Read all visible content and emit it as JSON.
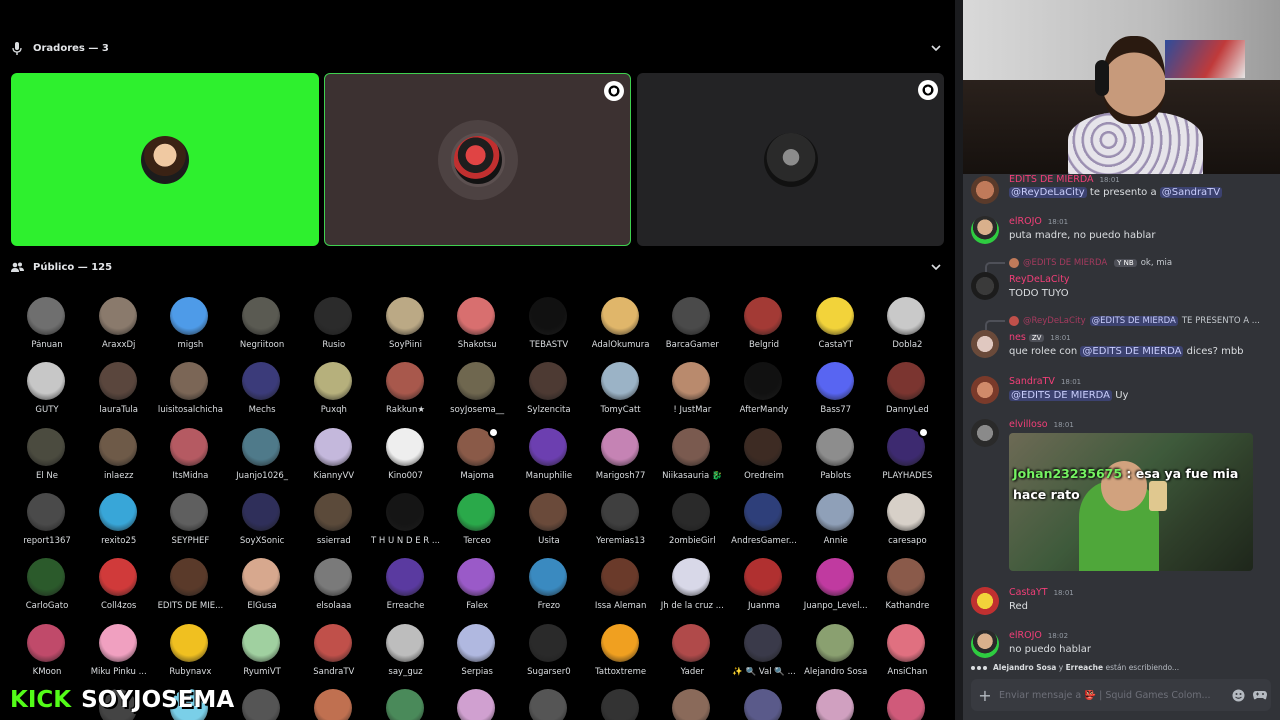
{
  "stage": {
    "speakers_title": "Oradores — 3",
    "audience_title": "Público — 125",
    "tiles": [
      {
        "name": "speaker-tile-1",
        "bg": "#2ef02e",
        "shield": false
      },
      {
        "name": "speaker-tile-2",
        "bg": "#3c3131",
        "shield": true
      },
      {
        "name": "speaker-tile-3",
        "bg": "#232325",
        "shield": true
      }
    ],
    "audience": [
      {
        "name": "Pánuan",
        "color": "#6f6f6f"
      },
      {
        "name": "AraxxDj",
        "color": "#8a7a6c"
      },
      {
        "name": "migsh",
        "color": "#4e9be8"
      },
      {
        "name": "Negriitoon",
        "color": "#5a5a52"
      },
      {
        "name": "Rusio",
        "color": "#2b2b2b"
      },
      {
        "name": "SoyPiini",
        "color": "#bba985"
      },
      {
        "name": "Shakotsu",
        "color": "#d86f6f"
      },
      {
        "name": "TEBASTV",
        "color": "#111111"
      },
      {
        "name": "AdalOkumura",
        "color": "#e0b66a"
      },
      {
        "name": "BarcaGamer",
        "color": "#4a4a4a"
      },
      {
        "name": "Belgrid",
        "color": "#a33a35"
      },
      {
        "name": "CastaYT",
        "color": "#f2d33a"
      },
      {
        "name": "Dobla2",
        "color": "#c9c9c9"
      },
      {
        "name": "GUTY",
        "color": "#c7c7c7"
      },
      {
        "name": "lauraTula",
        "color": "#5a463d"
      },
      {
        "name": "luisitosalchicha",
        "color": "#7b6656"
      },
      {
        "name": "Mechs",
        "color": "#3b3b7a"
      },
      {
        "name": "Puxqh",
        "color": "#b6b07c"
      },
      {
        "name": "Rakkun★",
        "color": "#a8584c"
      },
      {
        "name": "soyJosema__",
        "color": "#6f674f"
      },
      {
        "name": "Sylzencita",
        "color": "#4d3a33"
      },
      {
        "name": "TomyCatt",
        "color": "#9bb3c6"
      },
      {
        "name": "! JustMar",
        "color": "#b98a6d"
      },
      {
        "name": "AfterMandy",
        "color": "#111111"
      },
      {
        "name": "Bass77",
        "color": "#5865f2"
      },
      {
        "name": "DannyLed",
        "color": "#7b3530"
      },
      {
        "name": "El Ñe",
        "color": "#4b4b3f"
      },
      {
        "name": "inlaezz",
        "color": "#6e5a48"
      },
      {
        "name": "ItsMidna",
        "color": "#b55a62"
      },
      {
        "name": "Juanjo1026_",
        "color": "#4f7a8a"
      },
      {
        "name": "KiannyVV",
        "color": "#c4b8dc"
      },
      {
        "name": "Kino007",
        "color": "#eeeeee"
      },
      {
        "name": "Majoma",
        "color": "#8a5a48"
      },
      {
        "name": "Manuphilie",
        "color": "#6c3fb0"
      },
      {
        "name": "Marigosh77",
        "color": "#c583b4"
      },
      {
        "name": "Niikasauria 🐉",
        "color": "#7a5a4f"
      },
      {
        "name": "Oredreim",
        "color": "#3d2b23"
      },
      {
        "name": "Pablots",
        "color": "#8d8d8d"
      },
      {
        "name": "PLAYHADES",
        "color": "#3d2a70"
      },
      {
        "name": "report1367",
        "color": "#4a4a4a"
      },
      {
        "name": "rexito25",
        "color": "#38a6d8"
      },
      {
        "name": "SEYPHEF",
        "color": "#5f5f5f"
      },
      {
        "name": "SoyXSonic",
        "color": "#2f2f5a"
      },
      {
        "name": "ssierrad",
        "color": "#5b4a3a"
      },
      {
        "name": "T H U N D E R ...",
        "color": "#151515"
      },
      {
        "name": "Terceo",
        "color": "#2aa94a"
      },
      {
        "name": "Usita",
        "color": "#6a4a3a"
      },
      {
        "name": "Yeremias13",
        "color": "#3f3f3f"
      },
      {
        "name": "2ombieGirl",
        "color": "#2a2a2a"
      },
      {
        "name": "AndresGamer...",
        "color": "#2e3f7a"
      },
      {
        "name": "Annie",
        "color": "#8fa0b8"
      },
      {
        "name": "caresapo",
        "color": "#d7d0c8"
      },
      {
        "name": "CarloGato",
        "color": "#2b5a2b"
      },
      {
        "name": "Coll4zos",
        "color": "#d03a3a"
      },
      {
        "name": "EDITS DE MIE...",
        "color": "#5a3a2a"
      },
      {
        "name": "ElGusa",
        "color": "#d7a88e"
      },
      {
        "name": "elsolaaa",
        "color": "#7a7a7a"
      },
      {
        "name": "Erreache",
        "color": "#5a3aa0"
      },
      {
        "name": "Falex",
        "color": "#9a5ac8"
      },
      {
        "name": "Frezo",
        "color": "#3a8ac0"
      },
      {
        "name": "Issa Aleman",
        "color": "#6a3a2a"
      },
      {
        "name": "Jh de la cruz ...",
        "color": "#d8d8e8"
      },
      {
        "name": "Juanma",
        "color": "#b03030"
      },
      {
        "name": "Juanpo_Level...",
        "color": "#c03aa0"
      },
      {
        "name": "Kathandre",
        "color": "#8a5a4a"
      },
      {
        "name": "KMoon",
        "color": "#c04a6a"
      },
      {
        "name": "Miku Pinku ...",
        "color": "#f0a0c0"
      },
      {
        "name": "Rubynavx",
        "color": "#f0c020"
      },
      {
        "name": "RyumiVT",
        "color": "#a0d0a0"
      },
      {
        "name": "SandraTV",
        "color": "#c0504a"
      },
      {
        "name": "say_guz",
        "color": "#bdbdbd"
      },
      {
        "name": "Serpias",
        "color": "#b0b8e0"
      },
      {
        "name": "Sugarser0",
        "color": "#2a2a2a"
      },
      {
        "name": "Tattoxtreme",
        "color": "#f0a020"
      },
      {
        "name": "Yader",
        "color": "#b04a4a"
      },
      {
        "name": "✨ 🔍 Val 🔍 ...",
        "color": "#3a3a4a"
      },
      {
        "name": "Alejandro Sosa",
        "color": "#8aa070"
      },
      {
        "name": "AnsiChan",
        "color": "#e07080"
      }
    ],
    "audience_row7_colors": [
      "#444",
      "#7acfe8",
      "#555",
      "#c07050",
      "#4a8a5a",
      "#d0a0d0",
      "#555",
      "#333",
      "#8a6a5a",
      "#5a5a8a",
      "#d0a0c0",
      "#d05a7a"
    ]
  },
  "kick": {
    "brand": "KICK",
    "channel": "SOYJOSEMA"
  },
  "chat": {
    "messages": [
      {
        "author": "EDITS DE MIERDA",
        "time": "18:01",
        "pre": "",
        "mention1": "@ReyDeLaCity",
        "mid": " te presento a ",
        "mention2": "@SandraTV"
      },
      {
        "author": "elROJO",
        "time": "18:01",
        "text": "puta madre, no puedo hablar"
      },
      {
        "reply_author": "@EDITS DE MIERDA",
        "reply_tag": "Y NB",
        "reply_text": "ok, mia",
        "author": "ReyDeLaCity",
        "time": "",
        "text": "TODO TUYO"
      },
      {
        "reply_author": "@ReyDeLaCity",
        "reply_mention": "@EDITS DE MIERDA",
        "reply_text": "TE PRESENTO A ...",
        "author": "nes",
        "tag": "ZV",
        "time": "18:01",
        "pre": "que rolee con ",
        "mention1": "@EDITS DE MIERDA",
        "post": " dices? mbb"
      },
      {
        "author": "SandraTV",
        "time": "18:01",
        "mention1": "@EDITS DE MIERDA",
        "post": " Uy"
      },
      {
        "author": "elvilloso",
        "time": "18:01"
      },
      {
        "author": "CastaYT",
        "time": "18:01",
        "text": "Red"
      },
      {
        "author": "elROJO",
        "time": "18:02",
        "text": "no puedo hablar"
      }
    ],
    "gif": {
      "user": "Johan23235675",
      "caption": " : esa ya fue mia hace rato"
    },
    "typing": {
      "user1": "Alejandro Sosa",
      "joiner": " y ",
      "user2": "Erreache",
      "suffix": " están escribiendo..."
    },
    "composer": {
      "placeholder": "Enviar mensaje a  👺 | Squid Games Colom..."
    },
    "colors": {
      "author": "#f23f78",
      "mention_bg": "#3c4270",
      "mention_fg": "#c9cdfb"
    }
  }
}
